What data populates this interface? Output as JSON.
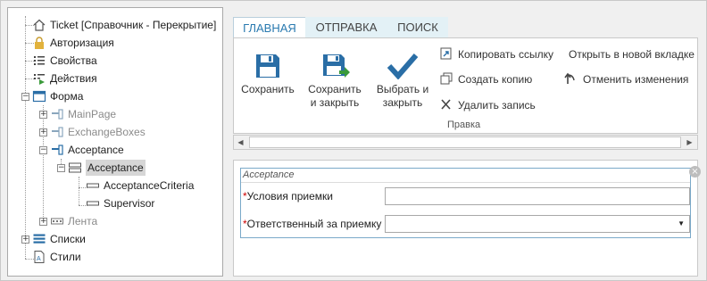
{
  "tree": {
    "items": [
      {
        "label": "Ticket [Справочник - Перекрытие]",
        "icon": "home-icon"
      },
      {
        "label": "Авторизация",
        "icon": "lock-icon"
      },
      {
        "label": "Свойства",
        "icon": "properties-list-icon"
      },
      {
        "label": "Действия",
        "icon": "actions-icon"
      },
      {
        "label": "Форма",
        "icon": "form-icon"
      },
      {
        "label": "MainPage",
        "icon": "tab-page-icon"
      },
      {
        "label": "ExchangeBoxes",
        "icon": "tab-page-icon"
      },
      {
        "label": "Acceptance",
        "icon": "tab-page-icon"
      },
      {
        "label": "Acceptance",
        "icon": "control-group-icon"
      },
      {
        "label": "AcceptanceCriteria",
        "icon": "control-icon"
      },
      {
        "label": "Supervisor",
        "icon": "control-icon"
      },
      {
        "label": "Лента",
        "icon": "ribbon-icon"
      },
      {
        "label": "Списки",
        "icon": "lists-icon"
      },
      {
        "label": "Стили",
        "icon": "styles-icon"
      }
    ]
  },
  "ribbon": {
    "tabs": [
      "ГЛАВНАЯ",
      "ОТПРАВКА",
      "ПОИСК"
    ],
    "buttons": {
      "save": "Сохранить",
      "save_close_1": "Сохранить",
      "save_close_2": "и закрыть",
      "select_close_1": "Выбрать и",
      "select_close_2": "закрыть",
      "copy_link": "Копировать ссылку",
      "create_copy": "Создать копию",
      "delete_record": "Удалить запись",
      "open_new_tab": "Открыть в новой вкладке",
      "undo_changes": "Отменить изменения"
    },
    "group_label": "Правка"
  },
  "form": {
    "group_title": "Acceptance",
    "required_mark": "*",
    "fields": [
      {
        "label": "Условия приемки",
        "value": ""
      },
      {
        "label": "Ответственный за приемку",
        "value": ""
      }
    ]
  },
  "colors": {
    "accent": "#2a7ab0",
    "save_icon": "#2a6ea6",
    "check_icon": "#2a6ea6",
    "arrow_green": "#3a9a3a",
    "required": "#cc0000"
  }
}
